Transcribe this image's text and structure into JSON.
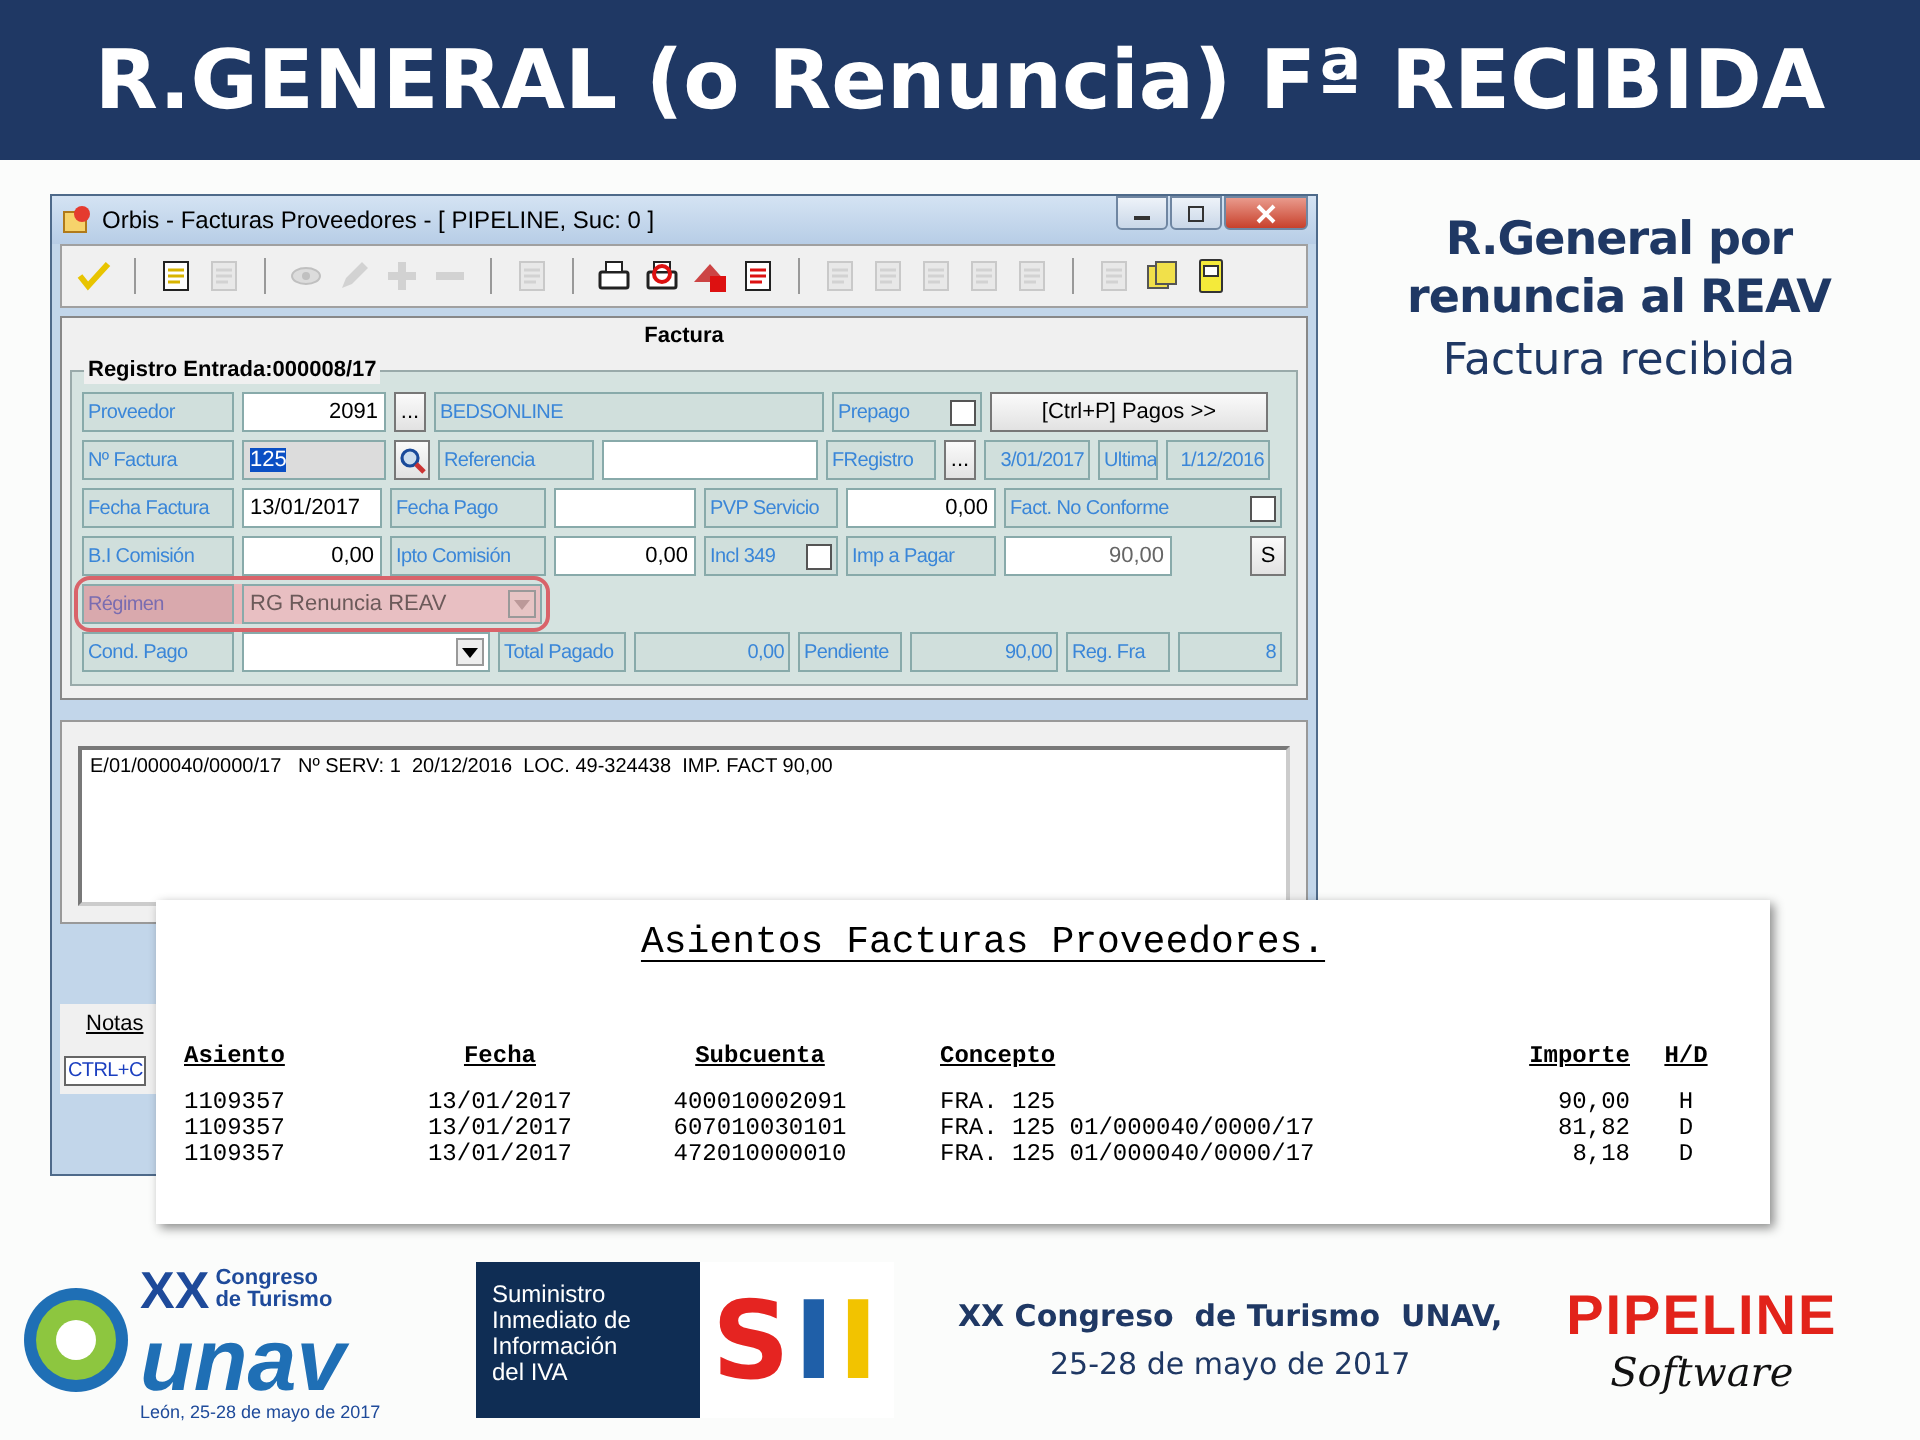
{
  "title": "R.GENERAL (o Renuncia) Fª RECIBIDA",
  "window": {
    "title": "Orbis - Facturas Proveedores - [ PIPELINE,  Suc: 0 ]",
    "toolbar": [
      {
        "kind": "tool",
        "disabled": false
      },
      {
        "kind": "separator"
      },
      {
        "kind": "tool",
        "disabled": false
      },
      {
        "kind": "tool",
        "disabled": true
      },
      {
        "kind": "separator"
      },
      {
        "kind": "tool",
        "disabled": true
      },
      {
        "kind": "tool",
        "disabled": true
      },
      {
        "kind": "tool",
        "disabled": true
      },
      {
        "kind": "tool",
        "disabled": true
      },
      {
        "kind": "separator"
      },
      {
        "kind": "tool",
        "disabled": true
      },
      {
        "kind": "separator"
      },
      {
        "kind": "tool",
        "disabled": false
      },
      {
        "kind": "tool",
        "disabled": false
      },
      {
        "kind": "tool",
        "disabled": false
      },
      {
        "kind": "tool",
        "disabled": false
      },
      {
        "kind": "separator"
      },
      {
        "kind": "tool",
        "disabled": true
      },
      {
        "kind": "tool",
        "disabled": true
      },
      {
        "kind": "tool",
        "disabled": true
      },
      {
        "kind": "tool",
        "disabled": true
      },
      {
        "kind": "tool",
        "disabled": true
      },
      {
        "kind": "separator"
      },
      {
        "kind": "tool",
        "disabled": true
      },
      {
        "kind": "tool",
        "disabled": false
      },
      {
        "kind": "tool",
        "disabled": false
      }
    ],
    "panel_title": "Factura",
    "group_title": "Registro Entrada:000008/17",
    "form_rows": [
      {
        "highlighted": false,
        "cells": [
          {
            "kind": "label",
            "text": "Proveedor"
          },
          {
            "kind": "number_input",
            "value": "2091"
          },
          {
            "kind": "button",
            "text": "..."
          },
          {
            "kind": "text_display",
            "value": "BEDSONLINE"
          },
          {
            "kind": "check_label",
            "text": "Prepago",
            "checked": false
          },
          {
            "kind": "button",
            "text": "[Ctrl+P] Pagos >>"
          }
        ]
      },
      {
        "highlighted": false,
        "cells": [
          {
            "kind": "label",
            "text": "Nº Factura"
          },
          {
            "kind": "text_input",
            "value": "125",
            "selected": true
          },
          {
            "kind": "search_button"
          },
          {
            "kind": "label",
            "text": "Referencia"
          },
          {
            "kind": "text_input"
          },
          {
            "kind": "label",
            "text": "FRegistro"
          },
          {
            "kind": "button",
            "text": "..."
          },
          {
            "kind": "number_display",
            "value": "3/01/2017"
          },
          {
            "kind": "label",
            "text": "Ultima"
          },
          {
            "kind": "number_display",
            "value": "1/12/2016"
          }
        ]
      },
      {
        "highlighted": false,
        "cells": [
          {
            "kind": "label",
            "text": "Fecha Factura"
          },
          {
            "kind": "text_input",
            "value": "13/01/2017",
            "selected": false
          },
          {
            "kind": "label",
            "text": "Fecha Pago"
          },
          {
            "kind": "text_input"
          },
          {
            "kind": "label",
            "text": "PVP Servicio"
          },
          {
            "kind": "number_input",
            "value": "0,00"
          },
          {
            "kind": "check_label",
            "text": "Fact. No Conforme",
            "checked": false
          }
        ]
      },
      {
        "highlighted": false,
        "cells": [
          {
            "kind": "label",
            "text": "B.I Comisión"
          },
          {
            "kind": "number_input",
            "value": "0,00"
          },
          {
            "kind": "label",
            "text": "Ipto Comisión"
          },
          {
            "kind": "number_input",
            "value": "0,00"
          },
          {
            "kind": "check_label",
            "text": "Incl 349",
            "checked": false
          },
          {
            "kind": "label",
            "text": "Imp a Pagar"
          },
          {
            "kind": "number_readonly",
            "value": "90,00"
          },
          {
            "kind": "button",
            "text": "S"
          }
        ]
      },
      {
        "highlighted": true,
        "cells": [
          {
            "kind": "label",
            "text": "Régimen"
          },
          {
            "kind": "combo",
            "value": "RG Renuncia REAV",
            "disabled": true
          }
        ]
      },
      {
        "highlighted": false,
        "cells": [
          {
            "kind": "label",
            "text": "Cond. Pago"
          },
          {
            "kind": "combo",
            "disabled": false
          },
          {
            "kind": "label",
            "text": "Total Pagado"
          },
          {
            "kind": "number_display",
            "value": "0,00"
          },
          {
            "kind": "label",
            "text": "Pendiente"
          },
          {
            "kind": "number_display",
            "value": "90,00"
          },
          {
            "kind": "label",
            "text": "Reg. Fra"
          },
          {
            "kind": "number_display",
            "value": "8"
          }
        ]
      }
    ],
    "notes": "E/01/000040/0000/17   Nº SERV: 1  20/12/2016  LOC. 49-324438  IMP. FACT 90,00",
    "notes_tab": "Notas",
    "status_bar": "CTRL+C"
  },
  "side_note": {
    "heading_lines": [
      "R.General por",
      "renuncia al REAV"
    ],
    "subheading": "Factura recibida"
  },
  "report": {
    "title": "Asientos Facturas Proveedores.",
    "columns": [
      "Asiento",
      "Fecha",
      "Subcuenta",
      "Concepto",
      "Importe",
      "H/D"
    ],
    "rows": [
      [
        "1109357",
        "13/01/2017",
        "400010002091",
        "FRA. 125",
        "90,00",
        "H"
      ],
      [
        "1109357",
        "13/01/2017",
        "607010030101",
        "FRA.  125 01/000040/0000/17",
        "81,82",
        "D"
      ],
      [
        "1109357",
        "13/01/2017",
        "472010000010",
        "FRA.  125 01/000040/0000/17",
        "8,18",
        "D"
      ]
    ]
  },
  "footer": {
    "unav_logo": {
      "numeral": "XX",
      "line_1": "Congreso",
      "line_2": "de Turismo",
      "word": "unav",
      "caption": "León, 25-28 de mayo de 2017"
    },
    "sii_logo": {
      "lines": [
        "Suministro",
        "Inmediato de",
        "Información",
        "del IVA"
      ],
      "letters": [
        {
          "text": "S",
          "color": "#e52421"
        },
        {
          "text": "I",
          "color": "#1f5fa8"
        },
        {
          "text": "I",
          "color": "#f2c300"
        }
      ]
    },
    "event": [
      "XX Congreso  de Turismo  UNAV,",
      "25-28 de mayo de 2017"
    ],
    "pipeline_logo": {
      "name": "PIPELINE",
      "tagline": "Software"
    }
  }
}
